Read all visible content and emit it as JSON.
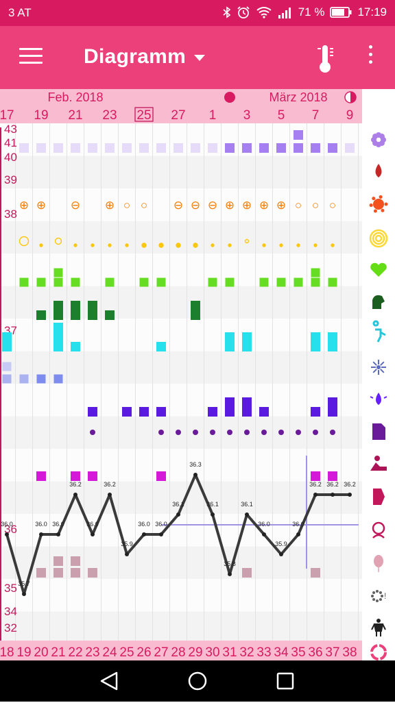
{
  "status_bar": {
    "carrier": "3 AT",
    "battery_percent": "71 %",
    "time": "17:19",
    "icons": [
      "bluetooth-icon",
      "alarm-icon",
      "wifi-icon",
      "signal-icon",
      "battery-icon"
    ]
  },
  "app_bar": {
    "title": "Diagramm",
    "menu_icon": "hamburger-menu-icon",
    "action_icon": "thermometer-icon",
    "overflow_icon": "more-vert-icon",
    "color": "#ec407a"
  },
  "header": {
    "month_labels": [
      "Feb. 2018",
      "März 2018"
    ],
    "dates": [
      "17",
      "19",
      "21",
      "23",
      "25",
      "27",
      "1",
      "3",
      "5",
      "7",
      "9"
    ],
    "highlighted_date": "25",
    "moon_icons": [
      "new-moon-icon",
      "half-moon-icon"
    ]
  },
  "temperature_scale": [
    "43",
    "41",
    "40",
    "39",
    "38",
    "37",
    "36",
    "35",
    "34",
    "32"
  ],
  "cycle_days": [
    "18",
    "19",
    "20",
    "21",
    "22",
    "23",
    "24",
    "25",
    "26",
    "27",
    "28",
    "29",
    "30",
    "31",
    "32",
    "33",
    "34",
    "35",
    "36",
    "37",
    "38"
  ],
  "row_labels": {
    "sex_symbols": [
      "⊕",
      "⊕",
      "⊕",
      "⊖",
      "⊕",
      "○",
      "○",
      "⊖",
      "⊖",
      "⊖",
      "⊕",
      "⊕",
      "⊕",
      "⊕",
      "○",
      "○",
      "○"
    ]
  },
  "chart_data": {
    "type": "line",
    "title": "",
    "xlabel": "",
    "ylabel": "",
    "x": [
      "18",
      "19",
      "20",
      "21",
      "22",
      "23",
      "24",
      "25",
      "26",
      "27",
      "28",
      "29",
      "30",
      "31",
      "32",
      "33",
      "34",
      "35",
      "36",
      "37",
      "38"
    ],
    "series": [
      {
        "values": [
          36.0,
          35.7,
          36.0,
          36.0,
          36.2,
          36.0,
          36.2,
          35.9,
          36.0,
          36.0,
          36.1,
          36.3,
          36.1,
          35.8,
          36.1,
          36.0,
          35.9,
          36.0,
          36.2,
          36.2,
          36.2
        ]
      }
    ],
    "point_labels": [
      "36.0",
      "35.7",
      "36.0",
      "36.0",
      "36.2",
      "36.0",
      "36.2",
      "35.9",
      "36.0",
      "36.0",
      "36.1",
      "36.3",
      "36.1",
      "35.8",
      "36.1",
      "36.0",
      "35.9",
      "36.0",
      "36.2",
      "36.2",
      "36.2"
    ],
    "coverline": 36.0,
    "ovulation_day": "35"
  },
  "side_icons": [
    {
      "name": "flower-icon",
      "color": "#ab7ee8"
    },
    {
      "name": "blood-drop-icon",
      "color": "#c62828"
    },
    {
      "name": "splash-icon",
      "color": "#f4511e"
    },
    {
      "name": "rings-icon",
      "color": "#fdd835"
    },
    {
      "name": "heart-icon",
      "color": "#64dd17"
    },
    {
      "name": "mood-icon",
      "color": "#1b5e20"
    },
    {
      "name": "urine-icon",
      "color": "#26c6da"
    },
    {
      "name": "sparkle-icon",
      "color": "#5c6bc0"
    },
    {
      "name": "water-drop-icon",
      "color": "#651fff"
    },
    {
      "name": "document-icon",
      "color": "#6a1b9a"
    },
    {
      "name": "activity-icon",
      "color": "#ad1457"
    },
    {
      "name": "tag-icon",
      "color": "#c2185b"
    },
    {
      "name": "headache-icon",
      "color": "#c2185b"
    },
    {
      "name": "balloon-icon",
      "color": "#e1a3b4"
    },
    {
      "name": "alert-icon",
      "color": "#616161"
    },
    {
      "name": "person-icon",
      "color": "#212121"
    },
    {
      "name": "cycle-icon",
      "color": "#ec407a"
    }
  ]
}
